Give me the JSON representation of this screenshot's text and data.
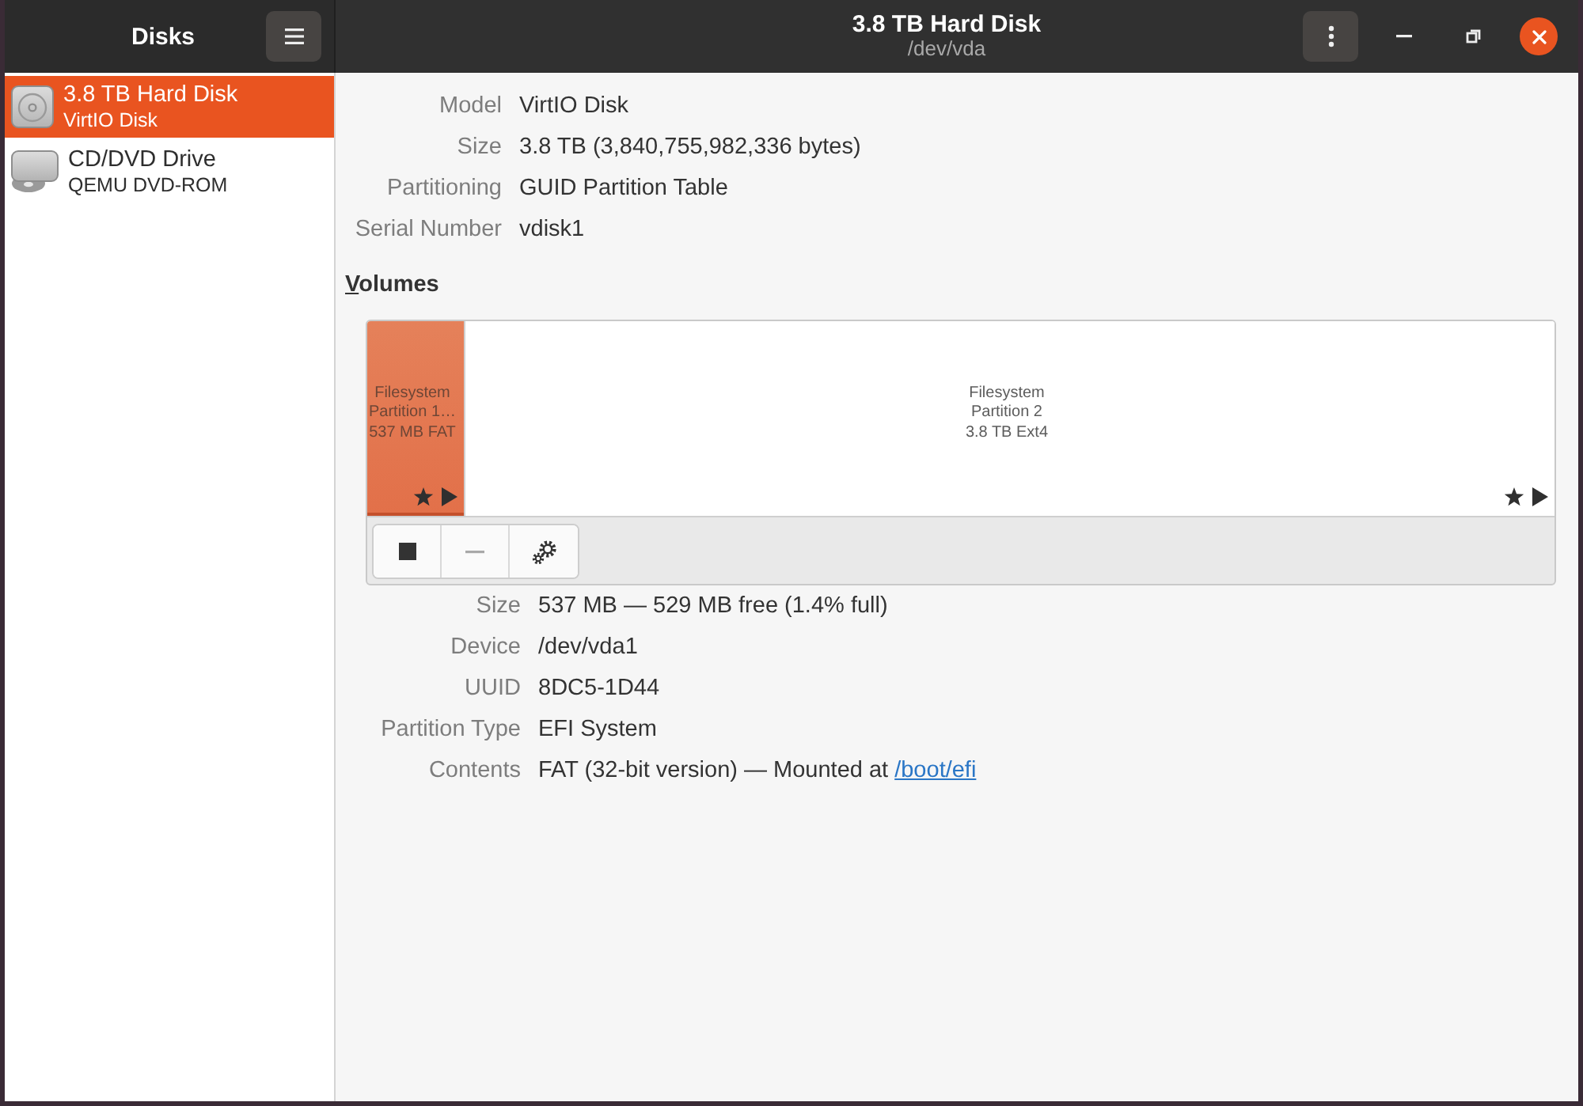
{
  "window": {
    "title": "3.8 TB Hard Disk",
    "subtitle": "/dev/vda"
  },
  "sidebar": {
    "title": "Disks",
    "items": [
      {
        "kind": "hard-disk",
        "title": "3.8 TB Hard Disk",
        "subtitle": "VirtIO Disk",
        "selected": true
      },
      {
        "kind": "optical",
        "title": "CD/DVD Drive",
        "subtitle": "QEMU DVD-ROM",
        "selected": false
      }
    ]
  },
  "disk_details": [
    {
      "label": "Model",
      "value": "VirtIO Disk"
    },
    {
      "label": "Size",
      "value": "3.8 TB (3,840,755,982,336 bytes)"
    },
    {
      "label": "Partitioning",
      "value": "GUID Partition Table"
    },
    {
      "label": "Serial Number",
      "value": "vdisk1"
    }
  ],
  "volumes": {
    "heading": "Volumes",
    "partitions": [
      {
        "lines": [
          "Filesystem",
          "Partition 1…",
          "537 MB FAT"
        ],
        "selected": true
      },
      {
        "lines": [
          "Filesystem",
          "Partition 2",
          "3.8 TB Ext4"
        ],
        "selected": false
      }
    ],
    "toolbar": [
      {
        "kind": "stop",
        "disabled": false
      },
      {
        "kind": "remove",
        "disabled": true
      },
      {
        "kind": "settings",
        "disabled": false
      }
    ]
  },
  "partition_details": [
    {
      "label": "Size",
      "value": "537 MB — 529 MB free (1.4% full)"
    },
    {
      "label": "Device",
      "value": "/dev/vda1"
    },
    {
      "label": "UUID",
      "value": "8DC5-1D44"
    },
    {
      "label": "Partition Type",
      "value": "EFI System"
    },
    {
      "label": "Contents",
      "value": "FAT (32-bit version) — Mounted at",
      "link": "/boot/efi"
    }
  ]
}
